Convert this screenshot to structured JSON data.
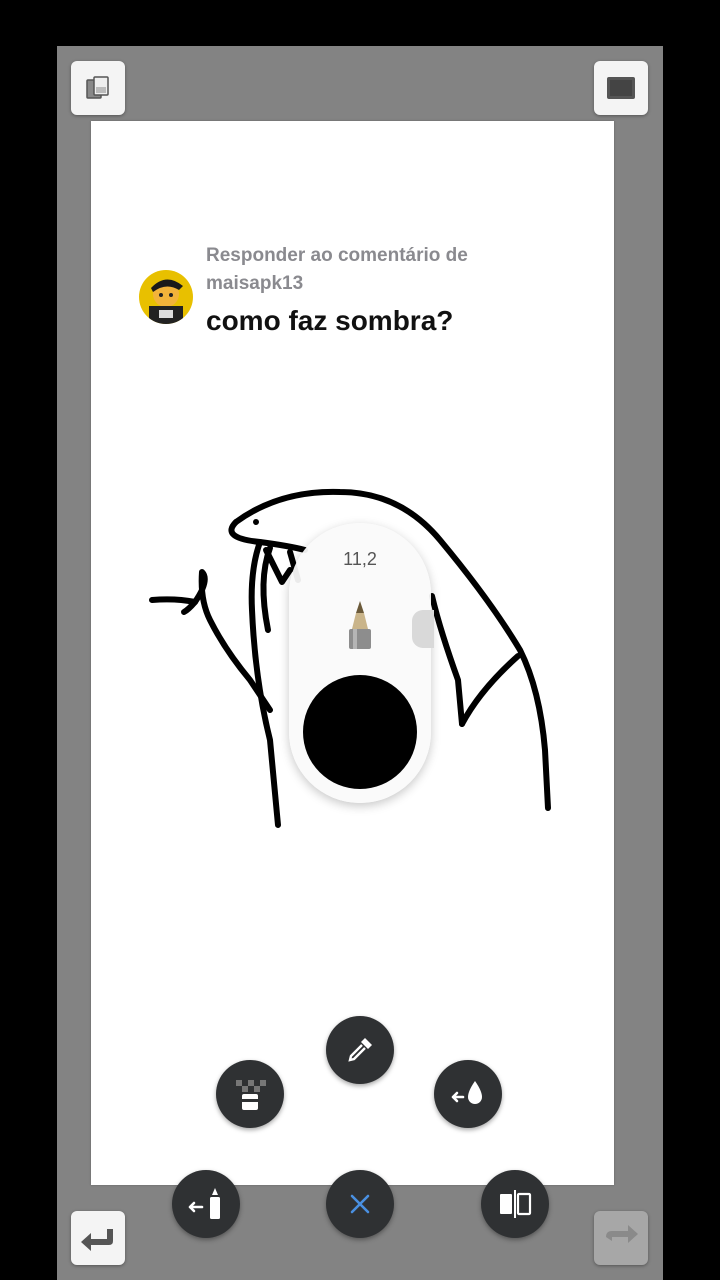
{
  "comment": {
    "reply_label": "Responder ao comentário de maisapk13",
    "text": "como faz sombra?"
  },
  "brush": {
    "size_label": "11,2",
    "color": "#000000"
  },
  "toolbar": {
    "top_left_icon": "layers-icon",
    "top_right_icon": "fullscreen-icon",
    "bottom_left_icon": "undo-icon",
    "bottom_right_icon": "redo-icon"
  },
  "tools": [
    {
      "name": "transparent-fill",
      "icon": "checker-bucket-icon"
    },
    {
      "name": "eyedropper",
      "icon": "eyedropper-icon"
    },
    {
      "name": "color-fill",
      "icon": "drop-icon"
    },
    {
      "name": "brush-select",
      "icon": "brush-icon"
    },
    {
      "name": "close",
      "icon": "close-icon"
    },
    {
      "name": "mirror",
      "icon": "mirror-icon"
    }
  ],
  "colors": {
    "workspace": "#838383",
    "tool_bg": "#2f3133",
    "accent": "#4a90e2"
  }
}
